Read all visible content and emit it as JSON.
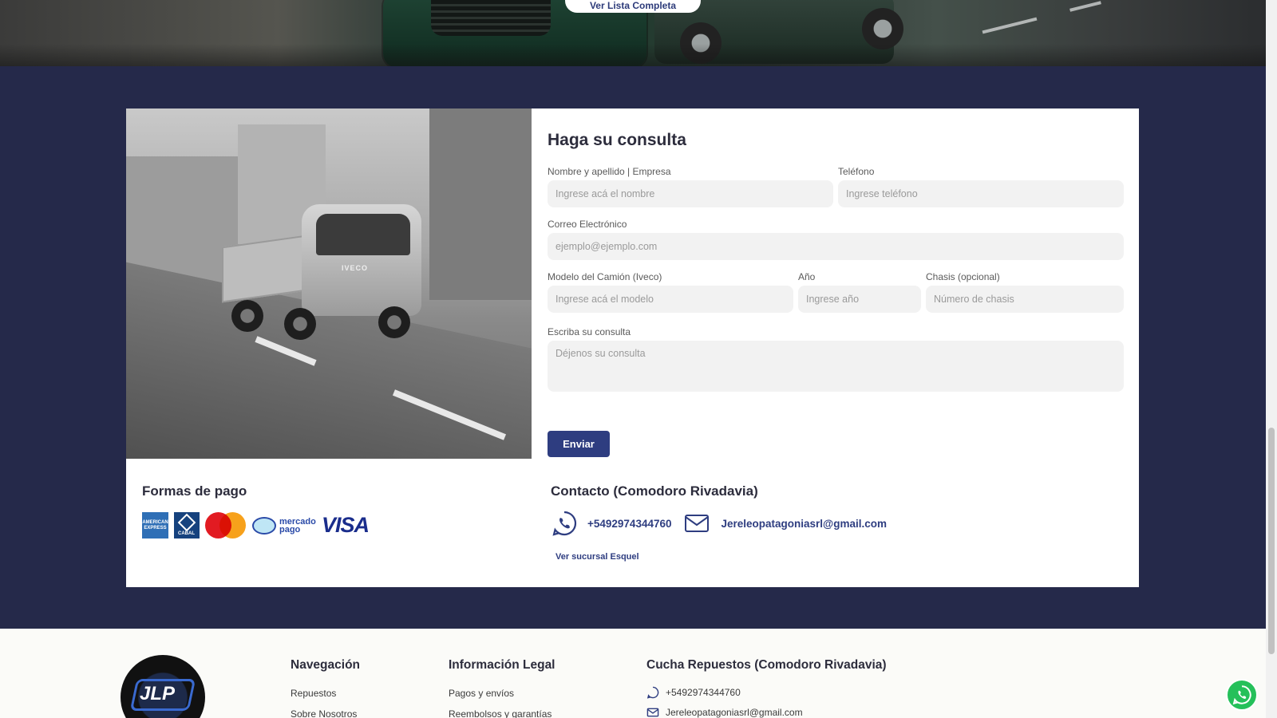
{
  "hero": {
    "button_label": "Ver Lista Completa"
  },
  "form": {
    "title": "Haga su consulta",
    "name_label": "Nombre y apellido | Empresa",
    "name_placeholder": "Ingrese acá el nombre",
    "phone_label": "Teléfono",
    "phone_placeholder": "Ingrese teléfono",
    "email_label": "Correo Electrónico",
    "email_placeholder": "ejemplo@ejemplo.com",
    "model_label": "Modelo del Camión (Iveco)",
    "model_placeholder": "Ingrese acá el modelo",
    "year_label": "Año",
    "year_placeholder": "Ingrese año",
    "chassis_label": "Chasis (opcional)",
    "chassis_placeholder": "Número de chasis",
    "message_label": "Escriba su consulta",
    "message_placeholder": "Déjenos su consulta",
    "submit_label": "Enviar"
  },
  "photo": {
    "brand_plate": "IVECO"
  },
  "payments": {
    "title": "Formas de pago",
    "amex_text": "AMERICAN EXPRESS",
    "cabal_text": "CABAL",
    "mercadopago_text": "mercado pago",
    "visa_text": "VISA"
  },
  "contact": {
    "title": "Contacto (Comodoro Rivadavia)",
    "phone": "+5492974344760",
    "email": "Jereleopatagoniasrl@gmail.com",
    "branch_link": "Ver sucursal Esquel"
  },
  "footer": {
    "logo_text": "JLP",
    "nav_title": "Navegación",
    "nav_items": [
      "Repuestos",
      "Sobre Nosotros"
    ],
    "legal_title": "Información Legal",
    "legal_items": [
      "Pagos y envíos",
      "Reembolsos y garantías"
    ],
    "store_title": "Cucha Repuestos (Comodoro Rivadavia)",
    "store_phone": "+5492974344760",
    "store_email": "Jereleopatagoniasrl@gmail.com"
  },
  "colors": {
    "navy": "#25294a",
    "accent": "#2e3d80",
    "whatsapp": "#25c05a"
  },
  "icons": [
    "whatsapp-icon",
    "mail-icon"
  ]
}
